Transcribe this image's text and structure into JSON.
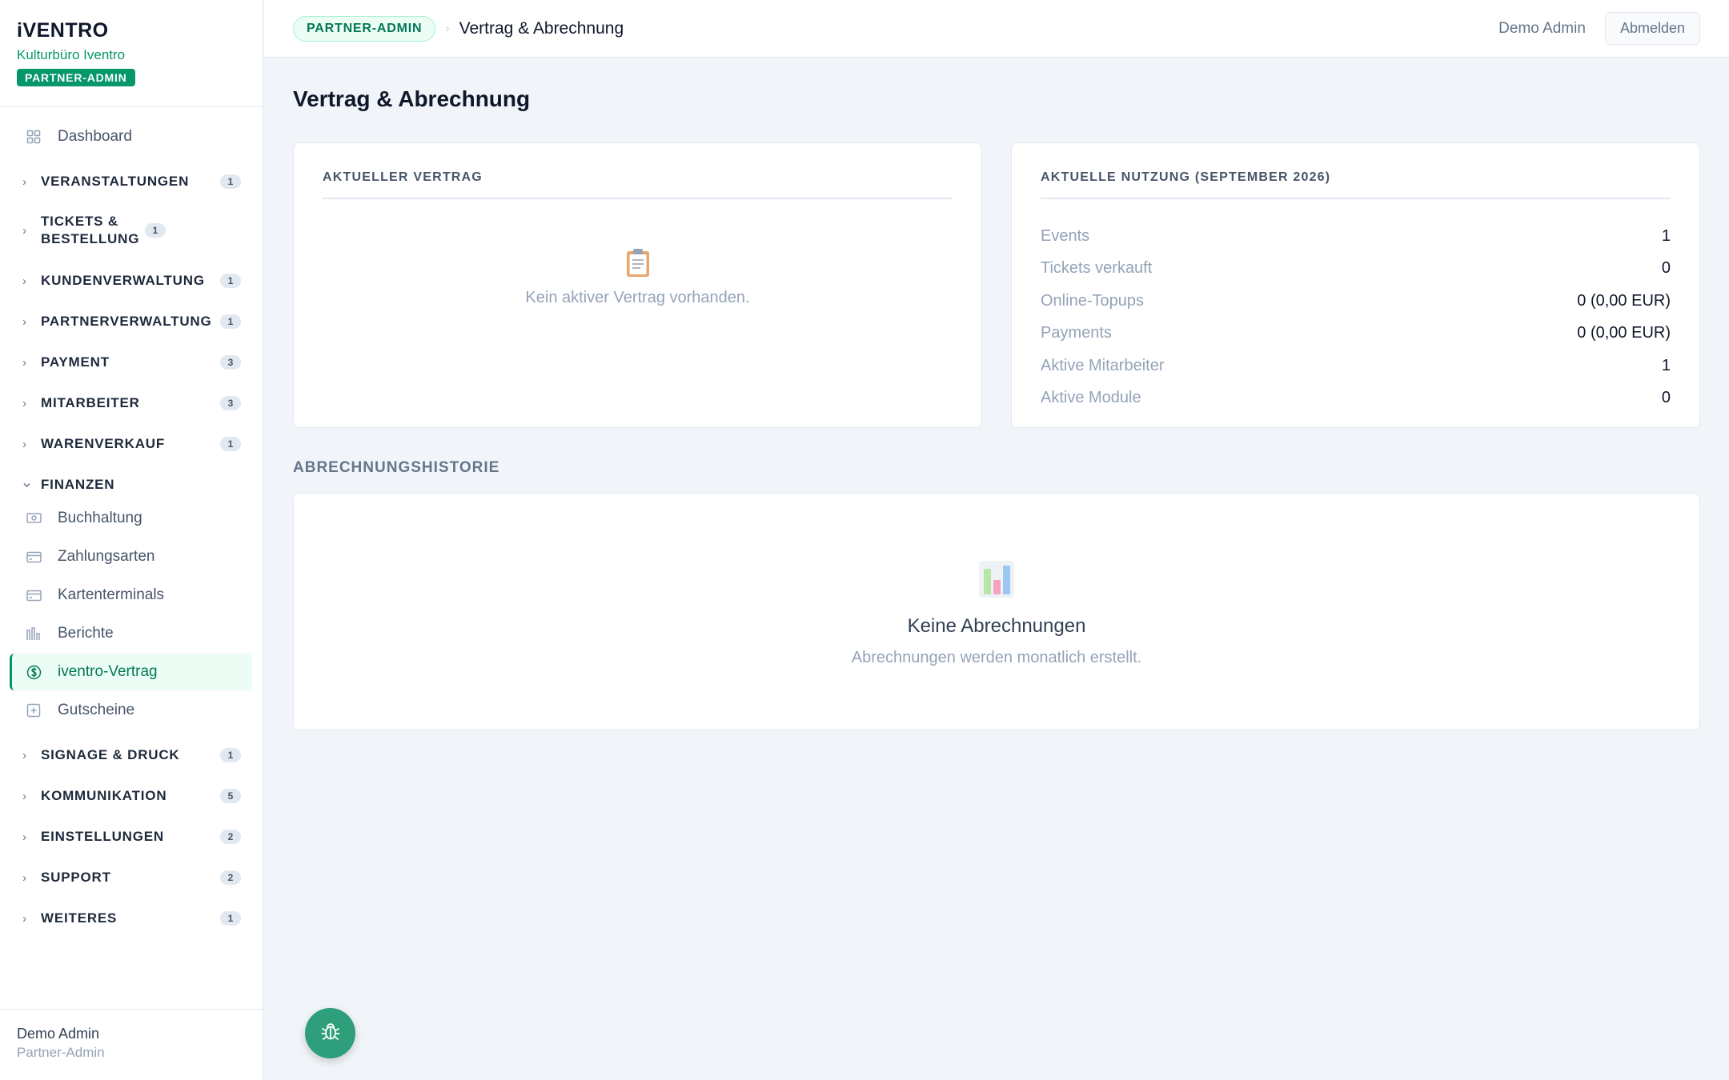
{
  "brand": {
    "logo": "iVENTRO",
    "org": "Kulturbüro Iventro",
    "badge": "PARTNER-ADMIN"
  },
  "sidebar": {
    "dashboard": "Dashboard",
    "groups": {
      "veranstaltungen": {
        "label": "VERANSTALTUNGEN",
        "count": "1"
      },
      "tickets": {
        "label": "TICKETS & BESTELLUNG",
        "count": "1"
      },
      "kunden": {
        "label": "KUNDENVERWALTUNG",
        "count": "1"
      },
      "partner": {
        "label": "PARTNERVERWALTUNG",
        "count": "1"
      },
      "payment": {
        "label": "PAYMENT",
        "count": "3"
      },
      "mitarbeiter": {
        "label": "MITARBEITER",
        "count": "3"
      },
      "waren": {
        "label": "WARENVERKAUF",
        "count": "1"
      },
      "finanzen": {
        "label": "FINANZEN"
      },
      "signage": {
        "label": "SIGNAGE & DRUCK",
        "count": "1"
      },
      "kommunikation": {
        "label": "KOMMUNIKATION",
        "count": "5"
      },
      "einstellungen": {
        "label": "EINSTELLUNGEN",
        "count": "2"
      },
      "support": {
        "label": "SUPPORT",
        "count": "2"
      },
      "weiteres": {
        "label": "WEITERES",
        "count": "1"
      }
    },
    "finanzen_items": {
      "buchhaltung": "Buchhaltung",
      "zahlungsarten": "Zahlungsarten",
      "kartenterminals": "Kartenterminals",
      "berichte": "Berichte",
      "vertrag": "iventro-Vertrag",
      "gutscheine": "Gutscheine"
    },
    "footer": {
      "name": "Demo Admin",
      "role": "Partner-Admin"
    }
  },
  "header": {
    "role_pill": "PARTNER-ADMIN",
    "separator": "›",
    "title": "Vertrag & Abrechnung",
    "user": "Demo Admin",
    "logout": "Abmelden"
  },
  "main": {
    "page_title": "Vertrag & Abrechnung",
    "contract": {
      "title": "AKTUELLER VERTRAG",
      "empty": "Kein aktiver Vertrag vorhanden."
    },
    "usage": {
      "title": "AKTUELLE NUTZUNG (SEPTEMBER 2026)",
      "rows": [
        {
          "label": "Events",
          "value": "1"
        },
        {
          "label": "Tickets verkauft",
          "value": "0"
        },
        {
          "label": "Online-Topups",
          "value": "0 (0,00 EUR)"
        },
        {
          "label": "Payments",
          "value": "0 (0,00 EUR)"
        },
        {
          "label": "Aktive Mitarbeiter",
          "value": "1"
        },
        {
          "label": "Aktive Module",
          "value": "0"
        }
      ]
    },
    "history": {
      "section_title": "ABRECHNUNGSHISTORIE",
      "empty_title": "Keine Abrechnungen",
      "empty_sub": "Abrechnungen werden monatlich erstellt."
    }
  },
  "colors": {
    "accent": "#059669",
    "accent_light": "#ecfdf5",
    "fab": "#2f9e7a"
  }
}
